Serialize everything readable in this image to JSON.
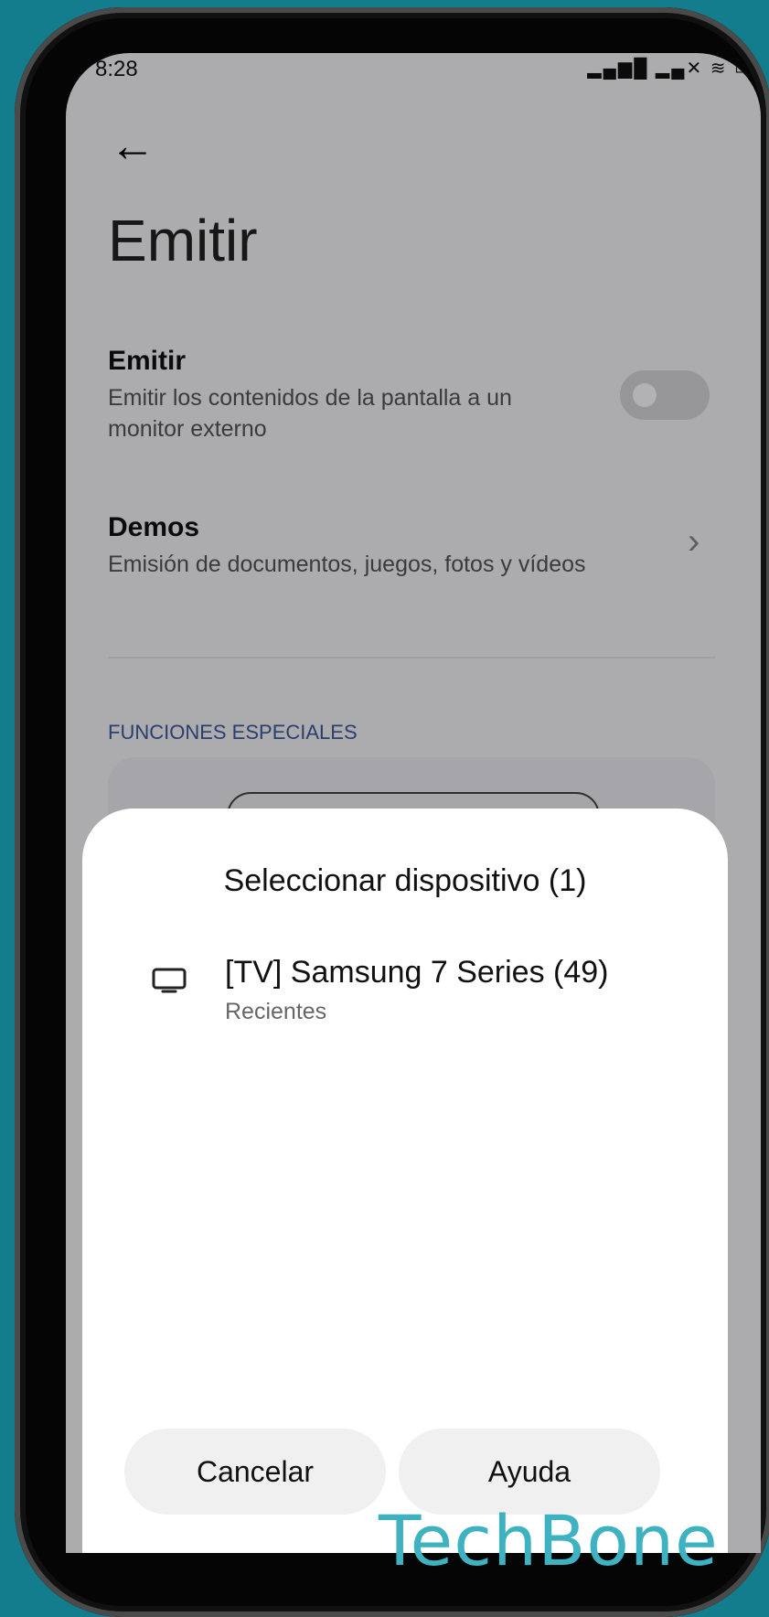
{
  "status_bar": {
    "time": "8:28",
    "icons": "▂▄▆█ ▂▄✕ ≋ ▭"
  },
  "header": {
    "title": "Emitir"
  },
  "settings": [
    {
      "title": "Emitir",
      "subtitle": "Emitir los contenidos de la pantalla a un monitor externo",
      "toggle_on": false
    },
    {
      "title": "Demos",
      "subtitle": "Emisión de documentos, juegos, fotos y vídeos"
    }
  ],
  "section": {
    "label": "FUNCIONES ESPECIALES"
  },
  "dialog": {
    "title": "Seleccionar dispositivo (1)",
    "devices": [
      {
        "name": "[TV] Samsung 7 Series (49)",
        "status": "Recientes",
        "icon": "tv-icon"
      }
    ],
    "cancel_label": "Cancelar",
    "help_label": "Ayuda"
  },
  "watermark": "TechBone",
  "colors": {
    "background": "#137d8d",
    "accent": "#3e5a9c",
    "watermark": "#3fb2c2"
  }
}
